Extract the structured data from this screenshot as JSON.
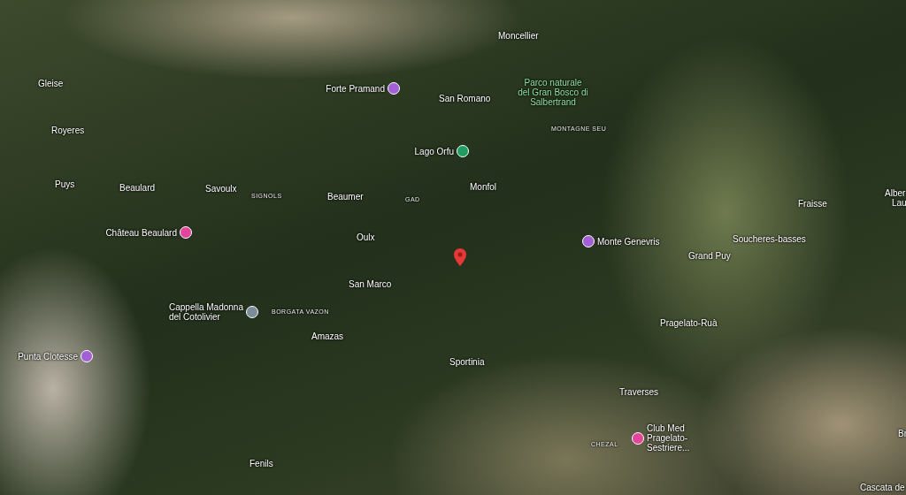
{
  "map": {
    "places": [
      {
        "kind": "place",
        "label": "Moncellier"
      },
      {
        "kind": "place",
        "label": "Gleise"
      },
      {
        "kind": "poi",
        "label": "Forte Pramand",
        "color": "#a35fd6"
      },
      {
        "kind": "place",
        "label": "San Romano"
      },
      {
        "kind": "park",
        "label": "Parco naturale del Gran Bosco di Salbertrand"
      },
      {
        "kind": "place",
        "label": "Royeres"
      },
      {
        "kind": "area",
        "label": "MONTAGNE SEU"
      },
      {
        "kind": "poi",
        "label": "Lago Orfu",
        "color": "#1e9e63"
      },
      {
        "kind": "place",
        "label": "Puys"
      },
      {
        "kind": "place",
        "label": "Beaulard"
      },
      {
        "kind": "place",
        "label": "Savoulx"
      },
      {
        "kind": "area",
        "label": "SIGNOLS"
      },
      {
        "kind": "place",
        "label": "Beaumer"
      },
      {
        "kind": "area",
        "label": "GAD"
      },
      {
        "kind": "place",
        "label": "Monfol"
      },
      {
        "kind": "place",
        "label": "Fraisse"
      },
      {
        "kind": "place",
        "label": "Alber"
      },
      {
        "kind": "place",
        "label": "Lau"
      },
      {
        "kind": "poi",
        "label": "Château Beaulard",
        "color": "#e2459a"
      },
      {
        "kind": "place",
        "label": "Oulx"
      },
      {
        "kind": "poi",
        "label": "Monte Genevris",
        "color": "#a35fd6"
      },
      {
        "kind": "place",
        "label": "Soucheres-basses"
      },
      {
        "kind": "place",
        "label": "Grand Puy"
      },
      {
        "kind": "place",
        "label": "San Marco"
      },
      {
        "kind": "poi",
        "label": "Cappella Madonna del Cotolivier",
        "color": "#7b8d99"
      },
      {
        "kind": "area",
        "label": "BORGATA VAZON"
      },
      {
        "kind": "place",
        "label": "Pragelato-Ruà"
      },
      {
        "kind": "place",
        "label": "Amazas"
      },
      {
        "kind": "poi",
        "label": "Punta Clotesse",
        "color": "#a35fd6"
      },
      {
        "kind": "place",
        "label": "Sportinia"
      },
      {
        "kind": "place",
        "label": "Traverses"
      },
      {
        "kind": "poi",
        "label": "Club Med Pragelato-Sestriere...",
        "color": "#e2459a"
      },
      {
        "kind": "place",
        "label": "Br"
      },
      {
        "kind": "area",
        "label": "CHEZAL"
      },
      {
        "kind": "place",
        "label": "Fenils"
      },
      {
        "kind": "place",
        "label": "Cascata de"
      }
    ]
  }
}
